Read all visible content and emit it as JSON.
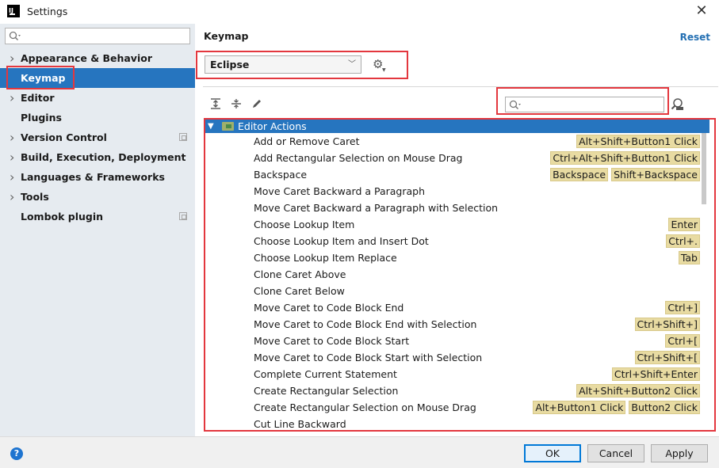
{
  "window": {
    "title": "Settings",
    "app_icon_text": "IJ"
  },
  "sidebar": {
    "search_placeholder": "",
    "items": [
      {
        "label": "Appearance & Behavior",
        "expandable": true
      },
      {
        "label": "Keymap",
        "expandable": false,
        "selected": true
      },
      {
        "label": "Editor",
        "expandable": true
      },
      {
        "label": "Plugins",
        "expandable": false
      },
      {
        "label": "Version Control",
        "expandable": true,
        "project_icon": true
      },
      {
        "label": "Build, Execution, Deployment",
        "expandable": true
      },
      {
        "label": "Languages & Frameworks",
        "expandable": true
      },
      {
        "label": "Tools",
        "expandable": true
      },
      {
        "label": "Lombok plugin",
        "expandable": false,
        "project_icon": true
      }
    ]
  },
  "main": {
    "title": "Keymap",
    "reset_label": "Reset",
    "keymap_selected": "Eclipse",
    "search_placeholder": ""
  },
  "tree": {
    "root_label": "Editor Actions",
    "rows": [
      {
        "label": "Add or Remove Caret",
        "shortcuts": [
          "Alt+Shift+Button1 Click"
        ]
      },
      {
        "label": "Add Rectangular Selection on Mouse Drag",
        "shortcuts": [
          "Ctrl+Alt+Shift+Button1 Click"
        ]
      },
      {
        "label": "Backspace",
        "shortcuts": [
          "Backspace",
          "Shift+Backspace"
        ]
      },
      {
        "label": "Move Caret Backward a Paragraph",
        "shortcuts": []
      },
      {
        "label": "Move Caret Backward a Paragraph with Selection",
        "shortcuts": []
      },
      {
        "label": "Choose Lookup Item",
        "shortcuts": [
          "Enter"
        ]
      },
      {
        "label": "Choose Lookup Item and Insert Dot",
        "shortcuts": [
          "Ctrl+."
        ]
      },
      {
        "label": "Choose Lookup Item Replace",
        "shortcuts": [
          "Tab"
        ]
      },
      {
        "label": "Clone Caret Above",
        "shortcuts": []
      },
      {
        "label": "Clone Caret Below",
        "shortcuts": []
      },
      {
        "label": "Move Caret to Code Block End",
        "shortcuts": [
          "Ctrl+]"
        ]
      },
      {
        "label": "Move Caret to Code Block End with Selection",
        "shortcuts": [
          "Ctrl+Shift+]"
        ]
      },
      {
        "label": "Move Caret to Code Block Start",
        "shortcuts": [
          "Ctrl+["
        ]
      },
      {
        "label": "Move Caret to Code Block Start with Selection",
        "shortcuts": [
          "Ctrl+Shift+["
        ]
      },
      {
        "label": "Complete Current Statement",
        "shortcuts": [
          "Ctrl+Shift+Enter"
        ]
      },
      {
        "label": "Create Rectangular Selection",
        "shortcuts": [
          "Alt+Shift+Button2 Click"
        ]
      },
      {
        "label": "Create Rectangular Selection on Mouse Drag",
        "shortcuts": [
          "Alt+Button1 Click",
          "Button2 Click"
        ]
      },
      {
        "label": "Cut Line Backward",
        "shortcuts": []
      }
    ]
  },
  "footer": {
    "help_label": "?",
    "ok_label": "OK",
    "cancel_label": "Cancel",
    "apply_label": "Apply"
  },
  "colors": {
    "accent": "#2675bf",
    "highlight_box": "#e3373e",
    "shortcut_bg": "#e8dba2",
    "sidebar_bg": "#e6ebf0",
    "link": "#2470b3"
  }
}
